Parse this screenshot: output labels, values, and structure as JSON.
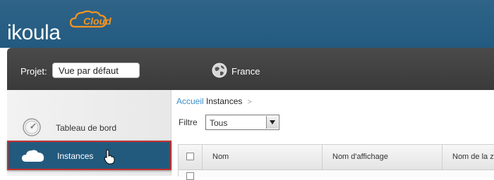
{
  "brand": {
    "name": "ikoula",
    "cloud": "Cloud",
    "accent": "#f7941d",
    "header_color": "#2b5f85"
  },
  "project_bar": {
    "label": "Projet:",
    "selected": "Vue par défaut",
    "region": "France",
    "region_icon": "globe-icon"
  },
  "sidebar": {
    "items": [
      {
        "label": "Tableau de bord",
        "icon": "dashboard-gauge-icon",
        "active": false
      },
      {
        "label": "Instances",
        "icon": "cloud-icon",
        "active": true
      }
    ]
  },
  "breadcrumb": {
    "home": "Accueil",
    "current": "Instances",
    "separator": ">"
  },
  "filter": {
    "label": "Filtre",
    "selected": "Tous"
  },
  "table": {
    "columns": [
      "Nom",
      "Nom d'affichage",
      "Nom de la z"
    ]
  }
}
